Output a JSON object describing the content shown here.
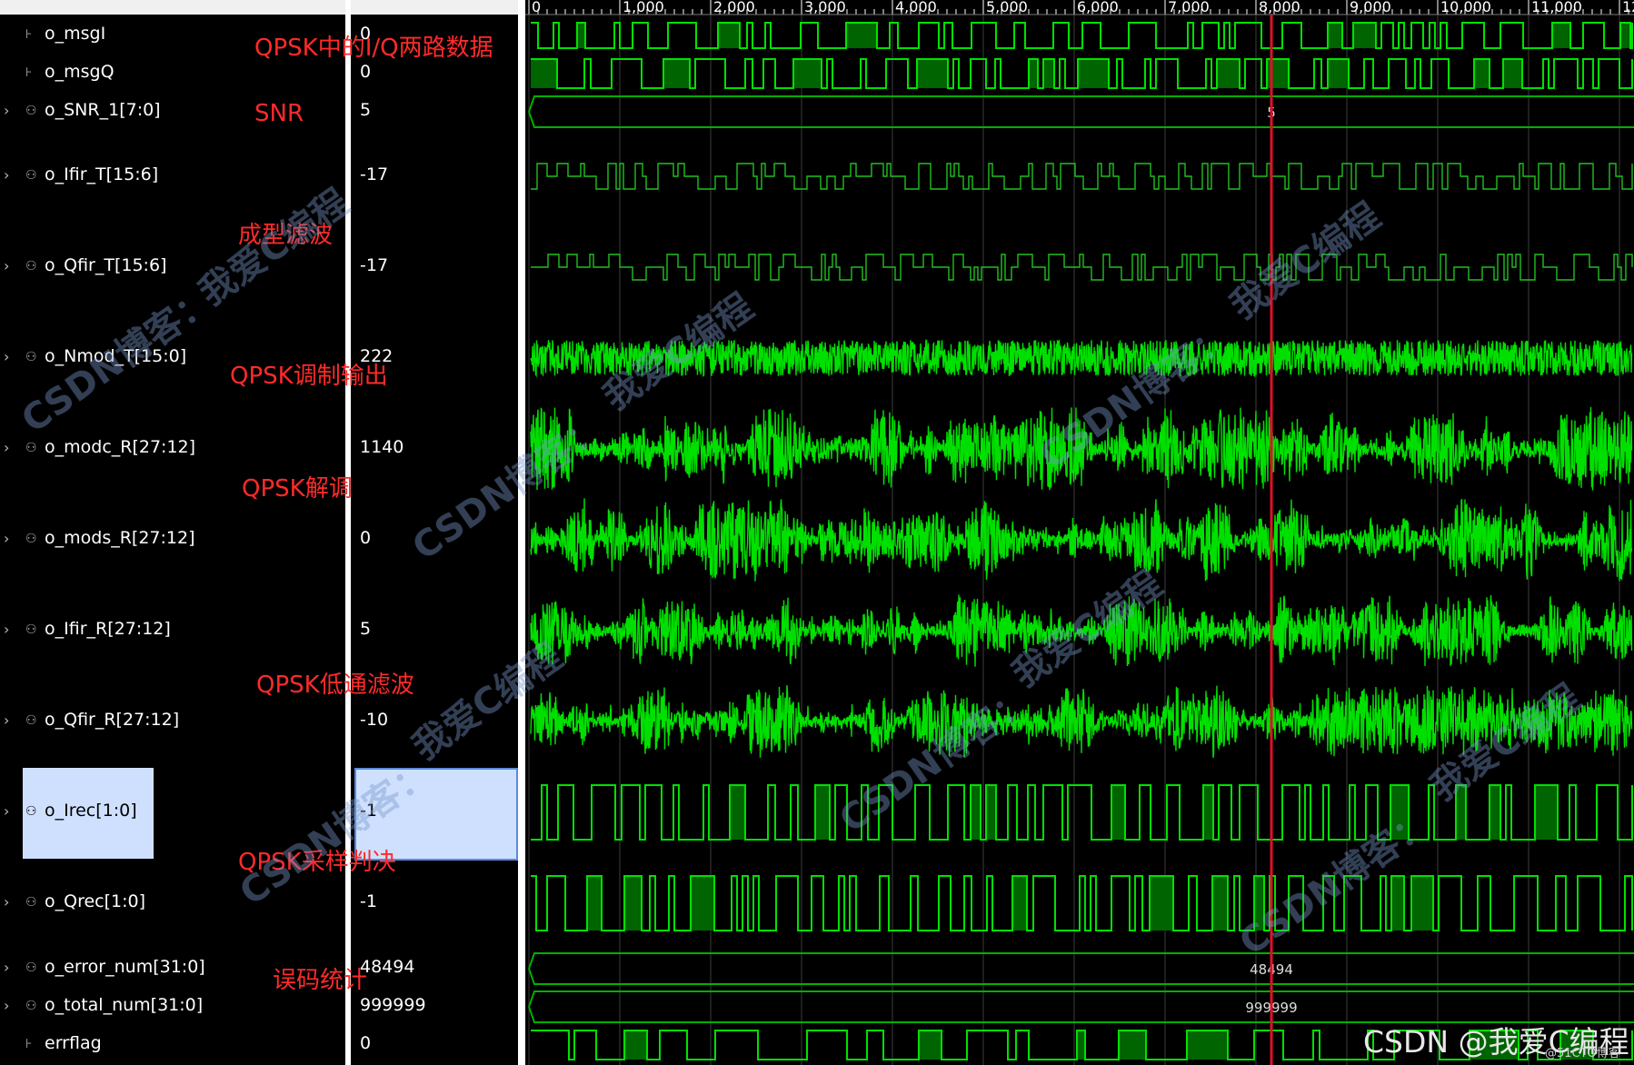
{
  "signals": [
    {
      "name": "o_msgI",
      "value": "0",
      "type": "bit"
    },
    {
      "name": "o_msgQ",
      "value": "0",
      "type": "bit"
    },
    {
      "name": "o_SNR_1[7:0]",
      "value": "5",
      "type": "bus"
    },
    {
      "name": "o_Ifir_T[15:6]",
      "value": "-17",
      "type": "bus"
    },
    {
      "name": "o_Qfir_T[15:6]",
      "value": "-17",
      "type": "bus"
    },
    {
      "name": "o_Nmod_T[15:0]",
      "value": "222",
      "type": "bus"
    },
    {
      "name": "o_modc_R[27:12]",
      "value": "1140",
      "type": "bus"
    },
    {
      "name": "o_mods_R[27:12]",
      "value": "0",
      "type": "bus"
    },
    {
      "name": "o_Ifir_R[27:12]",
      "value": "5",
      "type": "bus"
    },
    {
      "name": "o_Qfir_R[27:12]",
      "value": "-10",
      "type": "bus"
    },
    {
      "name": "o_Irec[1:0]",
      "value": "-1",
      "type": "bus"
    },
    {
      "name": "o_Qrec[1:0]",
      "value": "-1",
      "type": "bus"
    },
    {
      "name": "o_error_num[31:0]",
      "value": "48494",
      "type": "bus"
    },
    {
      "name": "o_total_num[31:0]",
      "value": "999999",
      "type": "bus"
    },
    {
      "name": "errflag",
      "value": "0",
      "type": "bit"
    }
  ],
  "selected_signal": "o_Irec[1:0]",
  "time_ticks": [
    "0",
    "1,000",
    "2,000",
    "3,000",
    "4,000",
    "5,000",
    "6,000",
    "7,000",
    "8,000",
    "9,000",
    "10,000",
    "11,000",
    "12"
  ],
  "cursor_time": "8,000",
  "bus_labels": {
    "snr": "5",
    "error_num": "48494",
    "total_num": "999999"
  },
  "annotations": [
    "QPSK中的I/Q两路数据",
    "SNR",
    "成型滤波",
    "QPSK调制输出",
    "QPSK解调",
    "QPSK低通滤波",
    "QPSK采样判决",
    "误码统计"
  ],
  "watermarks": {
    "blog": "CSDN博客：",
    "handle": "我爱C编程"
  },
  "footer": {
    "brand": "CSDN @我爱C编程",
    "small": "@51CTO博客"
  },
  "colors": {
    "wave": "#00e000",
    "wave_dark": "#006400",
    "cursor": "#e0102a",
    "bus": "#00b000",
    "grid": "#3c3c3c"
  }
}
